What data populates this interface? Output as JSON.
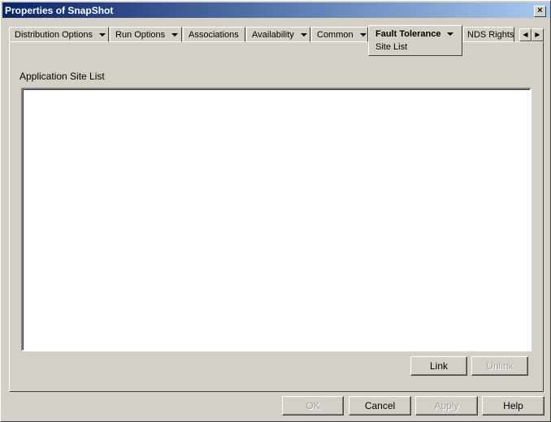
{
  "window": {
    "title": "Properties of SnapShot",
    "close": "×"
  },
  "tabs": [
    {
      "label": "Distribution Options"
    },
    {
      "label": "Run Options"
    },
    {
      "label": "Associations"
    },
    {
      "label": "Availability"
    },
    {
      "label": "Common"
    },
    {
      "label": "Fault Tolerance",
      "sub": "Site List"
    },
    {
      "label": "NDS Rights"
    }
  ],
  "scroll": {
    "left": "◀",
    "right": "▶"
  },
  "content": {
    "label": "Application Site List",
    "link": "Link",
    "unlink": "Unlink"
  },
  "footer": {
    "ok": "OK",
    "cancel": "Cancel",
    "apply": "Apply",
    "help": "Help"
  }
}
